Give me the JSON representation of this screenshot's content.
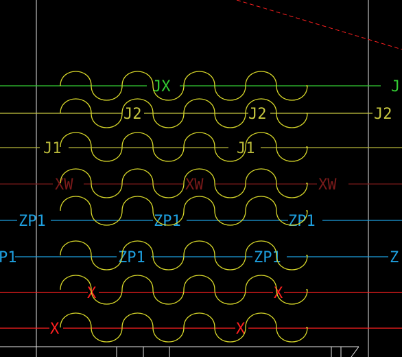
{
  "colors": {
    "background": "#000000",
    "wave": "#d9d92a",
    "grid_line": "#e6e6e6",
    "dashed": "#ff2020",
    "JX": "#33cc33",
    "J2": "#c8c840",
    "J1": "#b8b83a",
    "XW": "#7a1a1a",
    "ZP1": "#1ea0e0",
    "X": "#ff2020"
  },
  "lines": [
    {
      "id": "jx",
      "color_key": "JX",
      "labels": [
        "JX",
        "J"
      ]
    },
    {
      "id": "j2",
      "color_key": "J2",
      "labels": [
        "J2",
        "J2",
        "J2"
      ]
    },
    {
      "id": "j1",
      "color_key": "J1",
      "labels": [
        "J1",
        "J1"
      ]
    },
    {
      "id": "xw",
      "color_key": "XW",
      "labels": [
        "XW",
        "XW",
        "XW"
      ]
    },
    {
      "id": "zp1a",
      "color_key": "ZP1",
      "labels": [
        "ZP1",
        "ZP1",
        "ZP1"
      ]
    },
    {
      "id": "zp1b",
      "color_key": "ZP1",
      "labels": [
        "P1",
        "ZP1",
        "ZP1",
        "Z"
      ]
    },
    {
      "id": "xa",
      "color_key": "X",
      "labels": [
        "X",
        "X"
      ]
    },
    {
      "id": "xb",
      "color_key": "X",
      "labels": [
        "X",
        "X"
      ]
    }
  ],
  "wave_rows": 8,
  "wave_arches_per_row": 4
}
